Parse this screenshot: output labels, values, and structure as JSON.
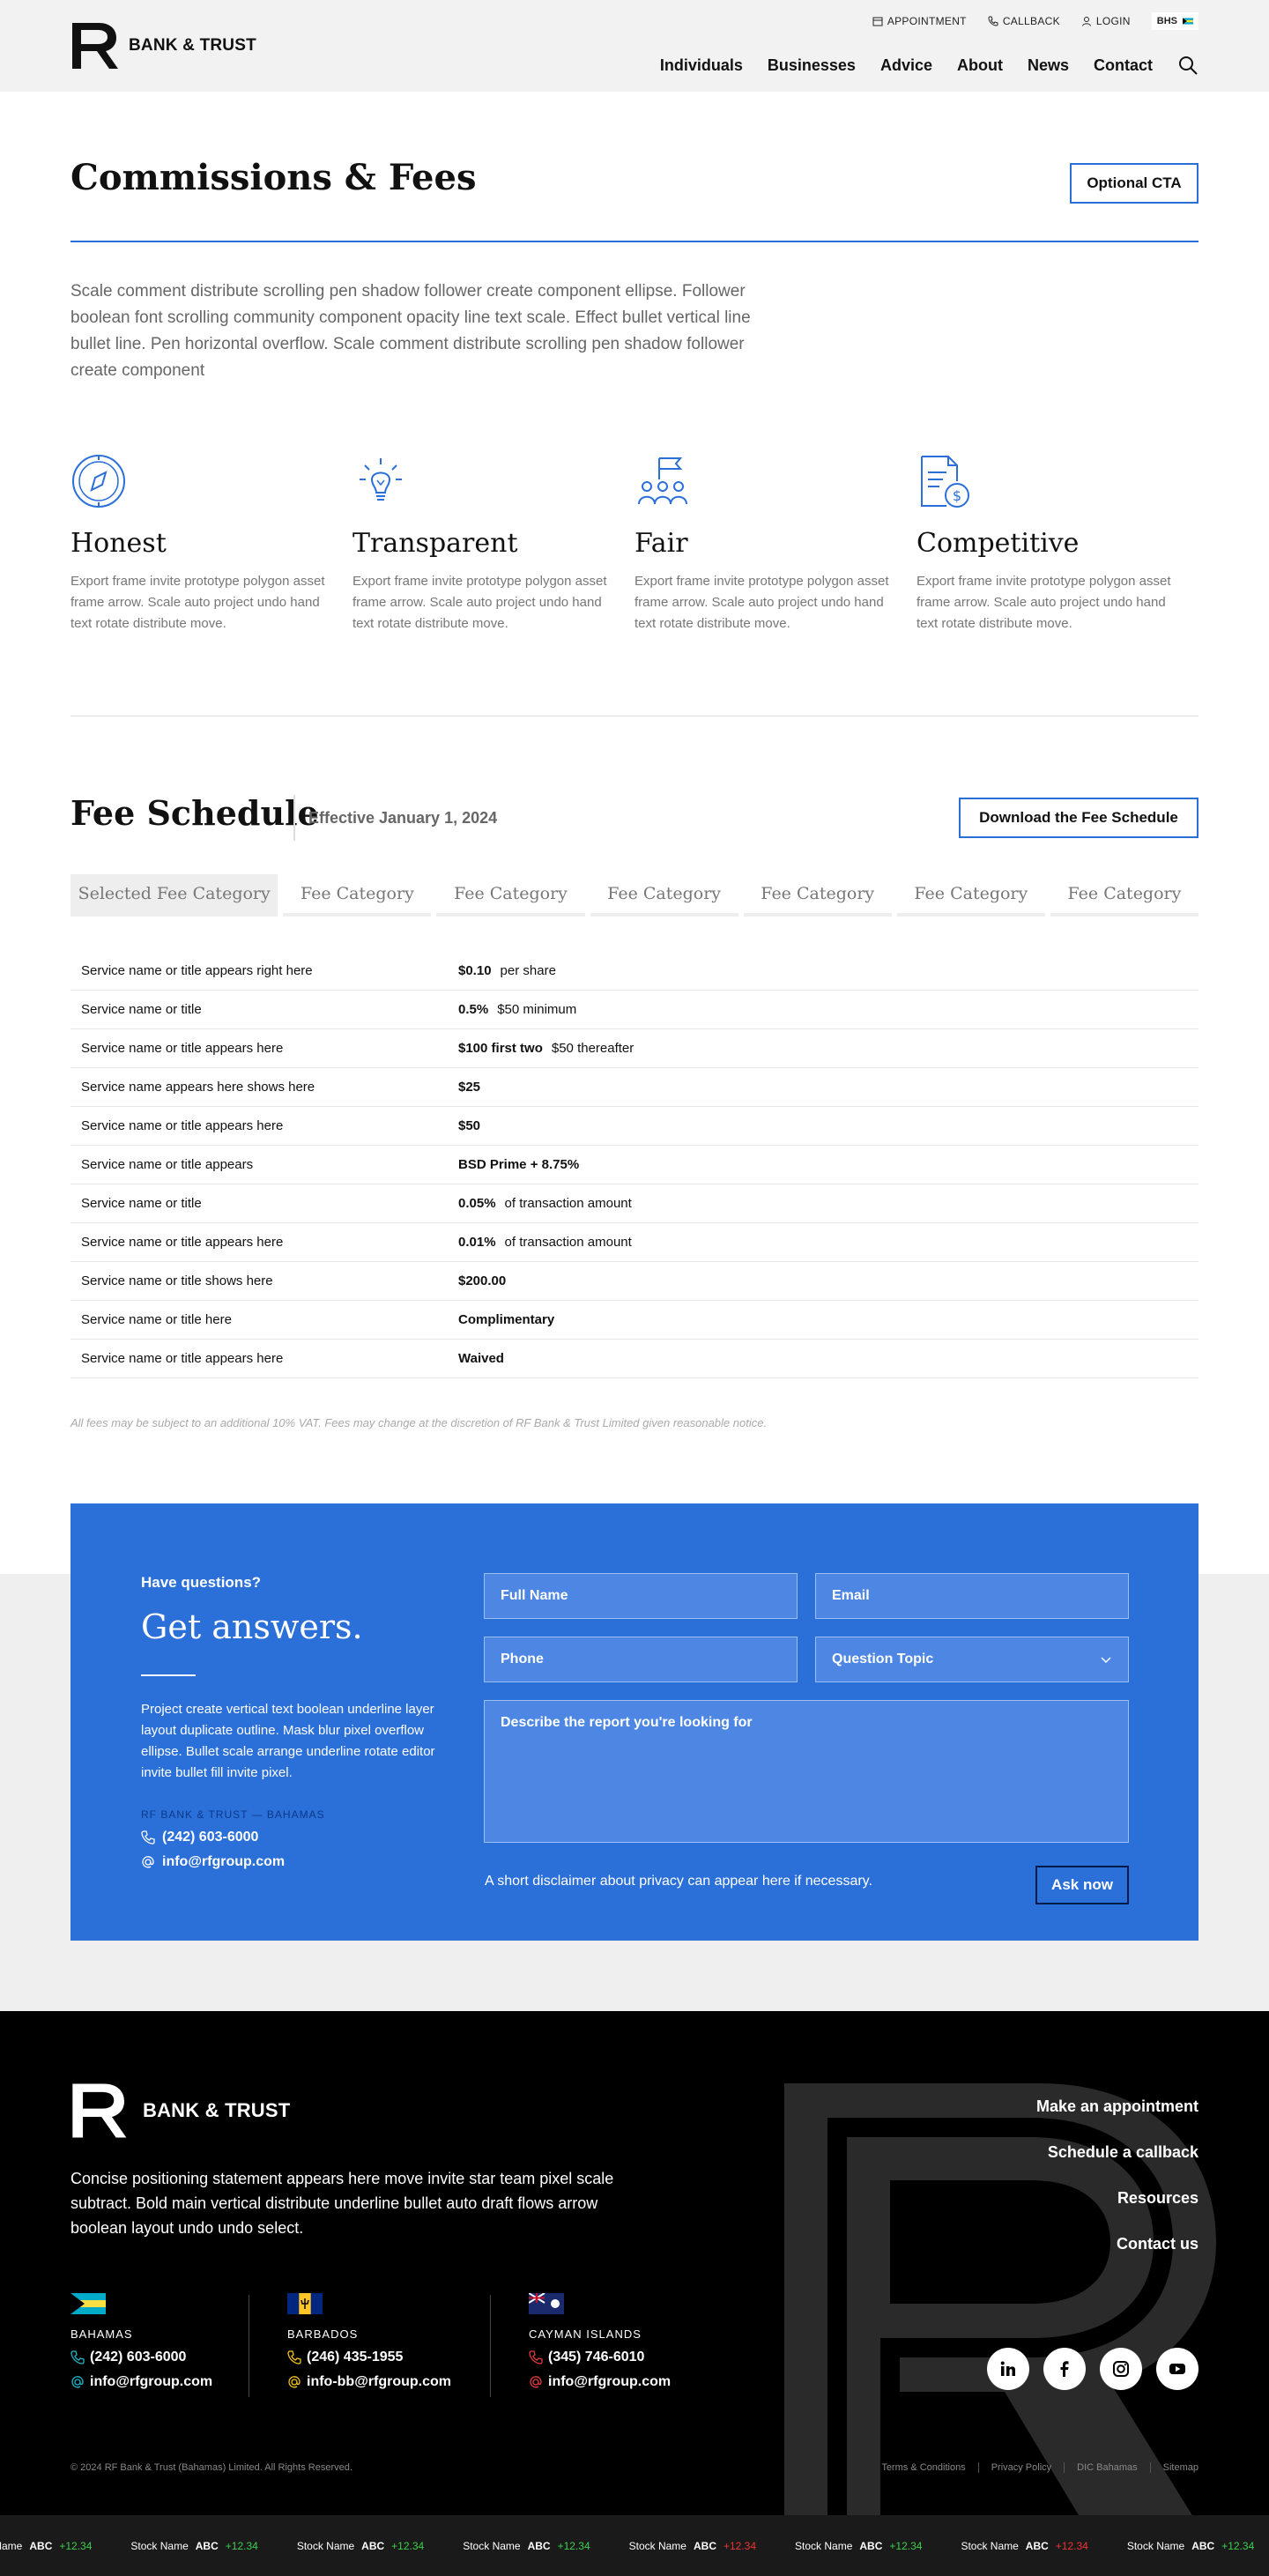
{
  "header": {
    "brand": "BANK & TRUST",
    "utility": {
      "appointment": "APPOINTMENT",
      "callback": "CALLBACK",
      "login": "LOGIN",
      "region": "BHS"
    },
    "nav": [
      "Individuals",
      "Businesses",
      "Advice",
      "About",
      "News",
      "Contact"
    ]
  },
  "intro": {
    "title": "Commissions & Fees",
    "cta": "Optional CTA",
    "description": "Scale comment distribute scrolling pen shadow follower create component ellipse. Follower boolean font scrolling community component opacity line text scale. Effect bullet vertical line bullet line. Pen horizontal overflow. Scale comment distribute scrolling pen shadow follower create component",
    "values": [
      {
        "icon": "compass-icon",
        "title": "Honest",
        "text": "Export frame invite prototype polygon asset frame arrow. Scale auto project undo hand text rotate distribute move."
      },
      {
        "icon": "lightbulb-icon",
        "title": "Transparent",
        "text": "Export frame invite prototype polygon asset frame arrow. Scale auto project undo hand text rotate distribute move."
      },
      {
        "icon": "people-flag-icon",
        "title": "Fair",
        "text": "Export frame invite prototype polygon asset frame arrow. Scale auto project undo hand text rotate distribute move."
      },
      {
        "icon": "document-dollar-icon",
        "title": "Competitive",
        "text": "Export frame invite prototype polygon asset frame arrow. Scale auto project undo hand text rotate distribute move."
      }
    ]
  },
  "fees": {
    "title": "Fee Schedule",
    "effective": "Effective January 1, 2024",
    "download": "Download the Fee Schedule",
    "tabs": [
      "Selected Fee Category",
      "Fee Category",
      "Fee Category",
      "Fee Category",
      "Fee Category",
      "Fee Category",
      "Fee Category"
    ],
    "rows": [
      {
        "service": "Service name or title appears right here",
        "amount": "$0.10",
        "detail": "per share"
      },
      {
        "service": "Service name or title",
        "amount": "0.5%",
        "detail": "$50 minimum"
      },
      {
        "service": "Service name or title appears here",
        "amount": "$100 first two",
        "detail": "$50 thereafter"
      },
      {
        "service": "Service name appears here shows here",
        "amount": "$25",
        "detail": ""
      },
      {
        "service": "Service name or title appears here",
        "amount": "$50",
        "detail": ""
      },
      {
        "service": "Service name or title appears",
        "amount": "BSD Prime + 8.75%",
        "detail": ""
      },
      {
        "service": "Service name or title",
        "amount": "0.05%",
        "detail": "of transaction amount"
      },
      {
        "service": "Service name or title appears here",
        "amount": "0.01%",
        "detail": "of transaction amount"
      },
      {
        "service": "Service name or title shows here",
        "amount": "$200.00",
        "detail": ""
      },
      {
        "service": "Service name or title  here",
        "amount": "Complimentary",
        "detail": ""
      },
      {
        "service": "Service name or title appears here",
        "amount": "Waived",
        "detail": ""
      }
    ],
    "note": "All fees may be subject to an additional 10% VAT. Fees may change at the discretion of RF Bank & Trust Limited given reasonable notice."
  },
  "contact": {
    "eyebrow": "Have questions?",
    "title": "Get answers.",
    "description": "Project create vertical text boolean underline layer layout duplicate outline. Mask blur pixel overflow ellipse. Bullet scale arrange underline rotate editor invite bullet fill invite pixel.",
    "place": "RF BANK & TRUST — BAHAMAS",
    "phone": "(242) 603-6000",
    "email": "info@rfgroup.com",
    "form": {
      "full_name": "Full Name",
      "email": "Email",
      "phone": "Phone",
      "topic": "Question Topic",
      "message": "Describe the report you're looking for"
    },
    "disclaimer": "A short disclaimer about privacy can appear here if necessary.",
    "submit": "Ask now"
  },
  "footer": {
    "brand": "BANK & TRUST",
    "description": "Concise positioning statement appears here move invite star team pixel scale subtract. Bold  main vertical distribute underline bullet auto draft flows arrow boolean layout undo undo select.",
    "links": [
      "Make an appointment",
      "Schedule a callback",
      "Resources",
      "Contact us"
    ],
    "offices": [
      {
        "name": "BAHAMAS",
        "phone": "(242) 603-6000",
        "email": "info@rfgroup.com",
        "accent": "#1fb6c9"
      },
      {
        "name": "BARBADOS",
        "phone": "(246) 435-1955",
        "email": "info-bb@rfgroup.com",
        "accent": "#f5c518"
      },
      {
        "name": "CAYMAN ISLANDS",
        "phone": "(345) 746-6010",
        "email": "info@rfgroup.com",
        "accent": "#e23b3b"
      }
    ],
    "socials": [
      "linkedin-icon",
      "facebook-icon",
      "instagram-icon",
      "youtube-icon"
    ],
    "copyright": "© 2024 RF Bank & Trust (Bahamas) Limited. All Rights Reserved.",
    "legal": [
      "Terms & Conditions",
      "Privacy Policy",
      "DIC Bahamas",
      "Sitemap"
    ]
  },
  "ticker": [
    {
      "name": "Stock Name",
      "sym": "ABC",
      "chg": "+12.34",
      "dir": "up"
    },
    {
      "name": "Stock Name",
      "sym": "ABC",
      "chg": "+12.34",
      "dir": "up"
    },
    {
      "name": "Stock Name",
      "sym": "ABC",
      "chg": "+12.34",
      "dir": "up"
    },
    {
      "name": "Stock Name",
      "sym": "ABC",
      "chg": "+12.34",
      "dir": "up"
    },
    {
      "name": "Stock Name",
      "sym": "ABC",
      "chg": "+12.34",
      "dir": "down"
    },
    {
      "name": "Stock Name",
      "sym": "ABC",
      "chg": "+12.34",
      "dir": "up"
    },
    {
      "name": "Stock Name",
      "sym": "ABC",
      "chg": "+12.34",
      "dir": "down"
    },
    {
      "name": "Stock Name",
      "sym": "ABC",
      "chg": "+12.34",
      "dir": "up"
    }
  ],
  "colors": {
    "accent": "#2b6fd9",
    "footer_bg": "#000000",
    "up": "#3ccf4e",
    "down": "#e33333"
  }
}
